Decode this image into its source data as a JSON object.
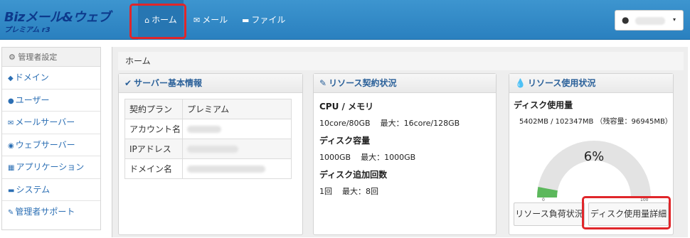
{
  "brand": {
    "name": "Bizメール&ウェブ",
    "edition": "プレミアム r3"
  },
  "nav": {
    "home": "ホーム",
    "mail": "メール",
    "file": "ファイル"
  },
  "user": {
    "caret": "▾"
  },
  "sidebar": {
    "header": "管理者設定",
    "items": [
      {
        "label": "ドメイン"
      },
      {
        "label": "ユーザー"
      },
      {
        "label": "メールサーバー"
      },
      {
        "label": "ウェブサーバー"
      },
      {
        "label": "アプリケーション"
      },
      {
        "label": "システム"
      },
      {
        "label": "管理者サポート"
      }
    ]
  },
  "breadcrumb": "ホーム",
  "server_panel": {
    "title": "サーバー基本情報",
    "rows": [
      {
        "key": "契約プラン",
        "value": "プレミアム"
      },
      {
        "key": "アカウント名",
        "value": ""
      },
      {
        "key": "IPアドレス",
        "value": ""
      },
      {
        "key": "ドメイン名",
        "value": ""
      }
    ]
  },
  "contract_panel": {
    "title": "リソース契約状況",
    "cpu_label": "CPU / メモリ",
    "cpu_current": "10core/80GB",
    "cpu_max": "最大：16core/128GB",
    "disk_label": "ディスク容量",
    "disk_current": "1000GB",
    "disk_max": "最大：1000GB",
    "add_label": "ディスク追加回数",
    "add_current": "1回",
    "add_max": "最大：8回"
  },
  "usage_panel": {
    "title": "リソース使用状況",
    "disk_title": "ディスク使用量",
    "disk_value": "5402MB / 102347MB （残容量：96945MB）",
    "percent_text": "6%",
    "percent": 6,
    "gauge_min": "0",
    "gauge_max": "100",
    "load_button": "リソース負荷状況",
    "disk_button": "ディスク使用量詳細",
    "gauge_color": "#5cb85c"
  }
}
